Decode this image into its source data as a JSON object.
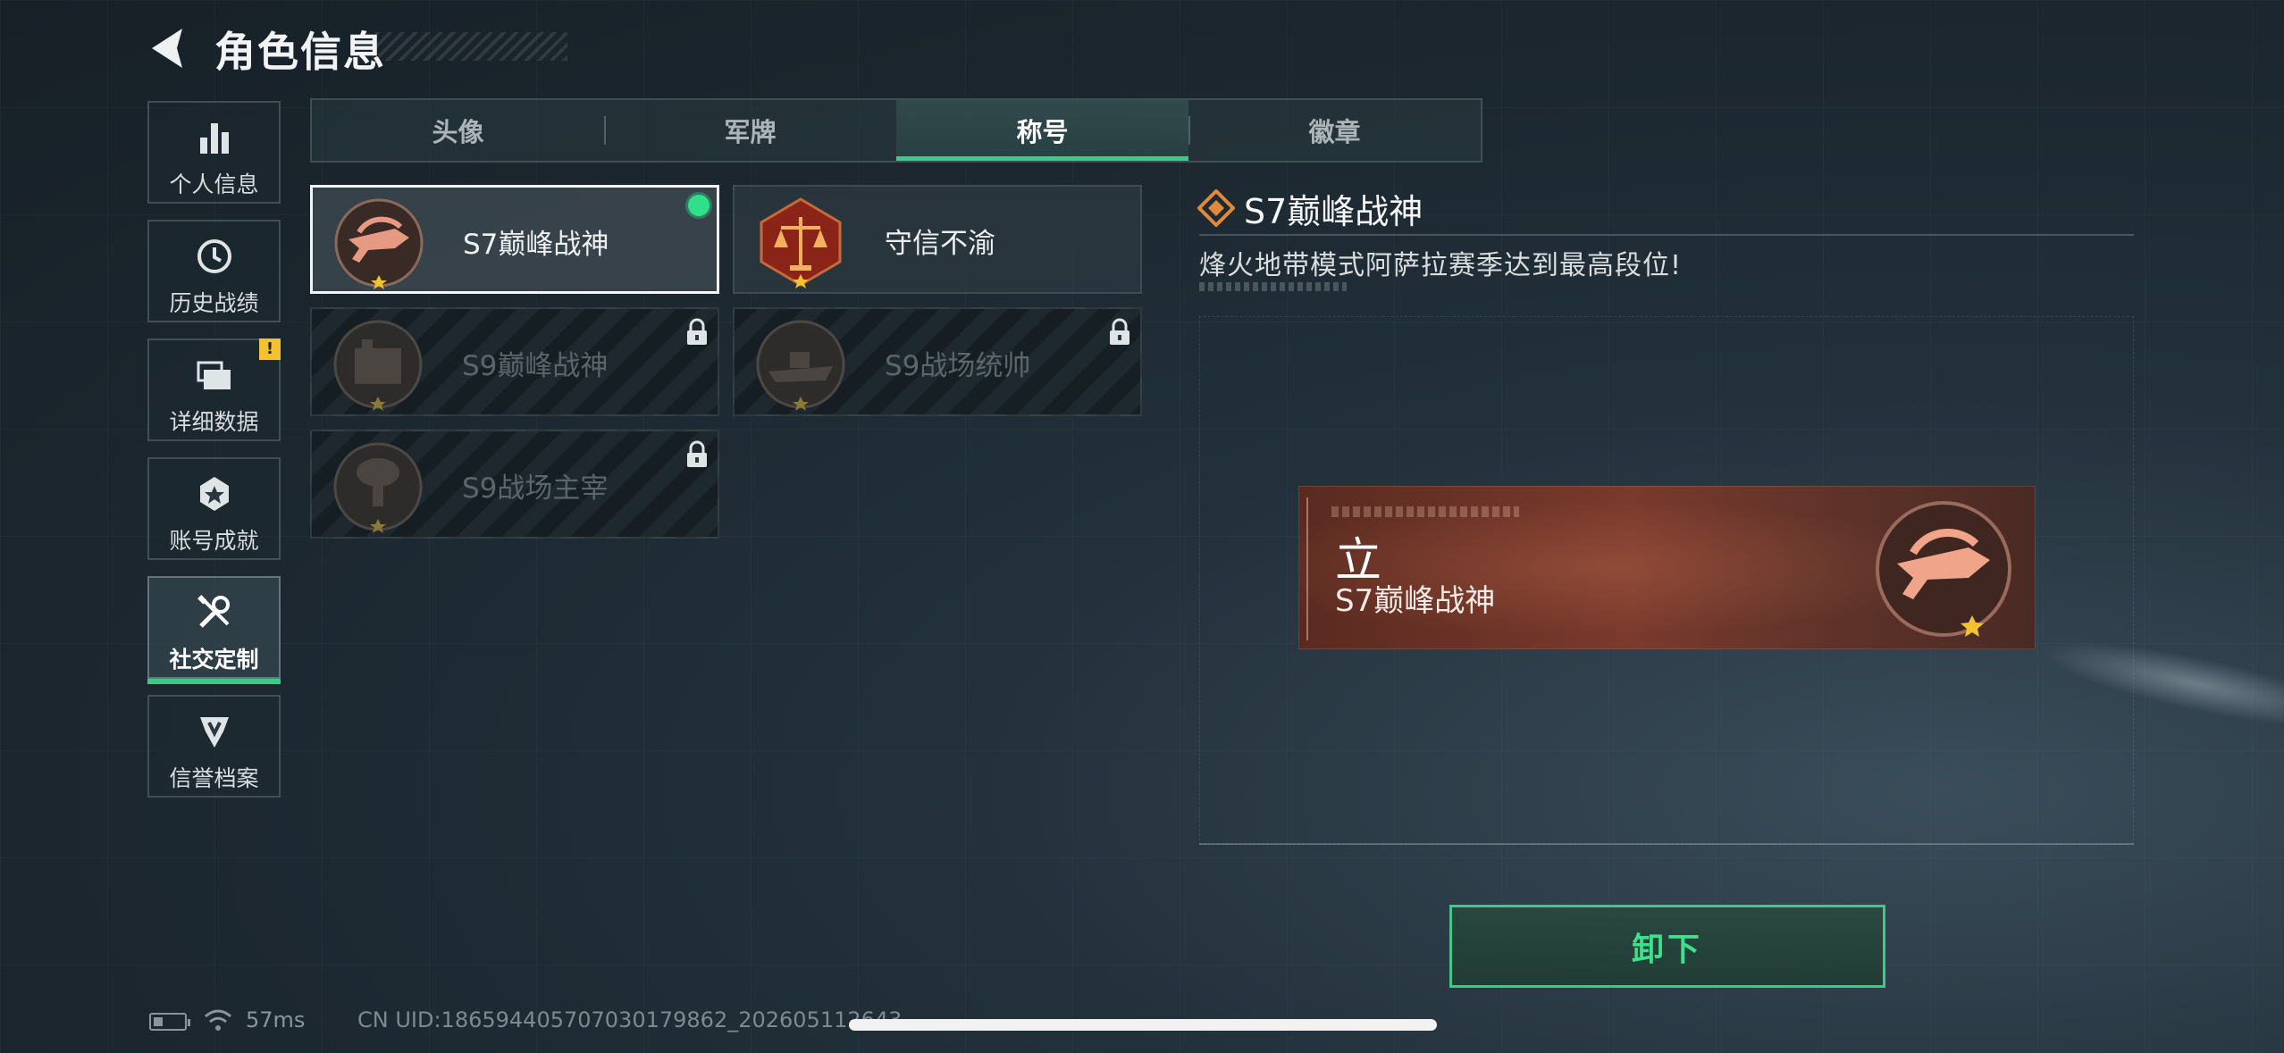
{
  "header": {
    "title": "角色信息"
  },
  "sidebar": {
    "items": [
      {
        "label": "个人信息",
        "icon": "bar-chart-icon"
      },
      {
        "label": "历史战绩",
        "icon": "history-clock-icon"
      },
      {
        "label": "详细数据",
        "icon": "folder-stack-icon",
        "badge": "!"
      },
      {
        "label": "账号成就",
        "icon": "achievement-star-icon"
      },
      {
        "label": "社交定制",
        "icon": "tools-wrench-icon",
        "active": true
      },
      {
        "label": "信誉档案",
        "icon": "reputation-shield-icon"
      }
    ]
  },
  "tabs": [
    {
      "label": "头像"
    },
    {
      "label": "军牌"
    },
    {
      "label": "称号",
      "active": true
    },
    {
      "label": "徽章"
    }
  ],
  "titles": [
    {
      "name": "S7巅峰战神",
      "emblem": "crossbow-emblem",
      "selected": true,
      "equipped": true,
      "locked": false
    },
    {
      "name": "守信不渝",
      "emblem": "scales-emblem",
      "selected": false,
      "locked": false
    },
    {
      "name": "S9巅峰战神",
      "emblem": "building-emblem",
      "locked": true
    },
    {
      "name": "S9战场统帅",
      "emblem": "warship-emblem",
      "locked": true
    },
    {
      "name": "S9战场主宰",
      "emblem": "mushroom-cloud-emblem",
      "locked": true
    }
  ],
  "detail": {
    "title": "S7巅峰战神",
    "description": "烽火地带模式阿萨拉赛季达到最高段位!",
    "banner_char": "立",
    "banner_title": "S7巅峰战神"
  },
  "actions": {
    "unequip_label": "卸下"
  },
  "status_bar": {
    "ping": "57ms",
    "uid": "CN UID:18659440570703017986​2_202605112643"
  },
  "colors": {
    "accent": "#3ec88a",
    "warning": "#f2c230",
    "banner": "#7a3a2c"
  }
}
